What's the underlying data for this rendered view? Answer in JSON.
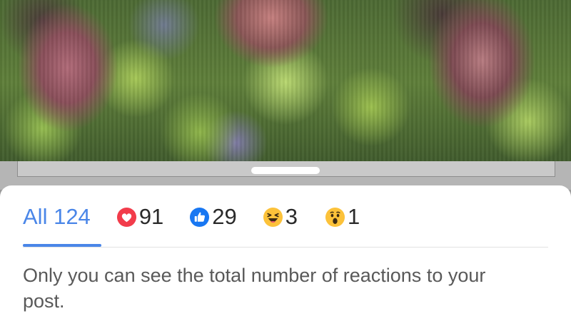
{
  "colors": {
    "accent": "#4a86e8",
    "love": "#f23c4b",
    "like": "#1877f2",
    "emoji_yellow": "#fcc23a"
  },
  "reactions": {
    "tabs": [
      {
        "key": "all",
        "label": "All",
        "count": "124",
        "selected": true
      },
      {
        "key": "love",
        "icon": "love-reaction-icon",
        "count": "91"
      },
      {
        "key": "like",
        "icon": "like-reaction-icon",
        "count": "29"
      },
      {
        "key": "haha",
        "icon": "haha-reaction-icon",
        "count": "3"
      },
      {
        "key": "wow",
        "icon": "wow-reaction-icon",
        "count": "1"
      }
    ]
  },
  "notice": {
    "text": "Only you can see the total number of reactions to your post."
  }
}
